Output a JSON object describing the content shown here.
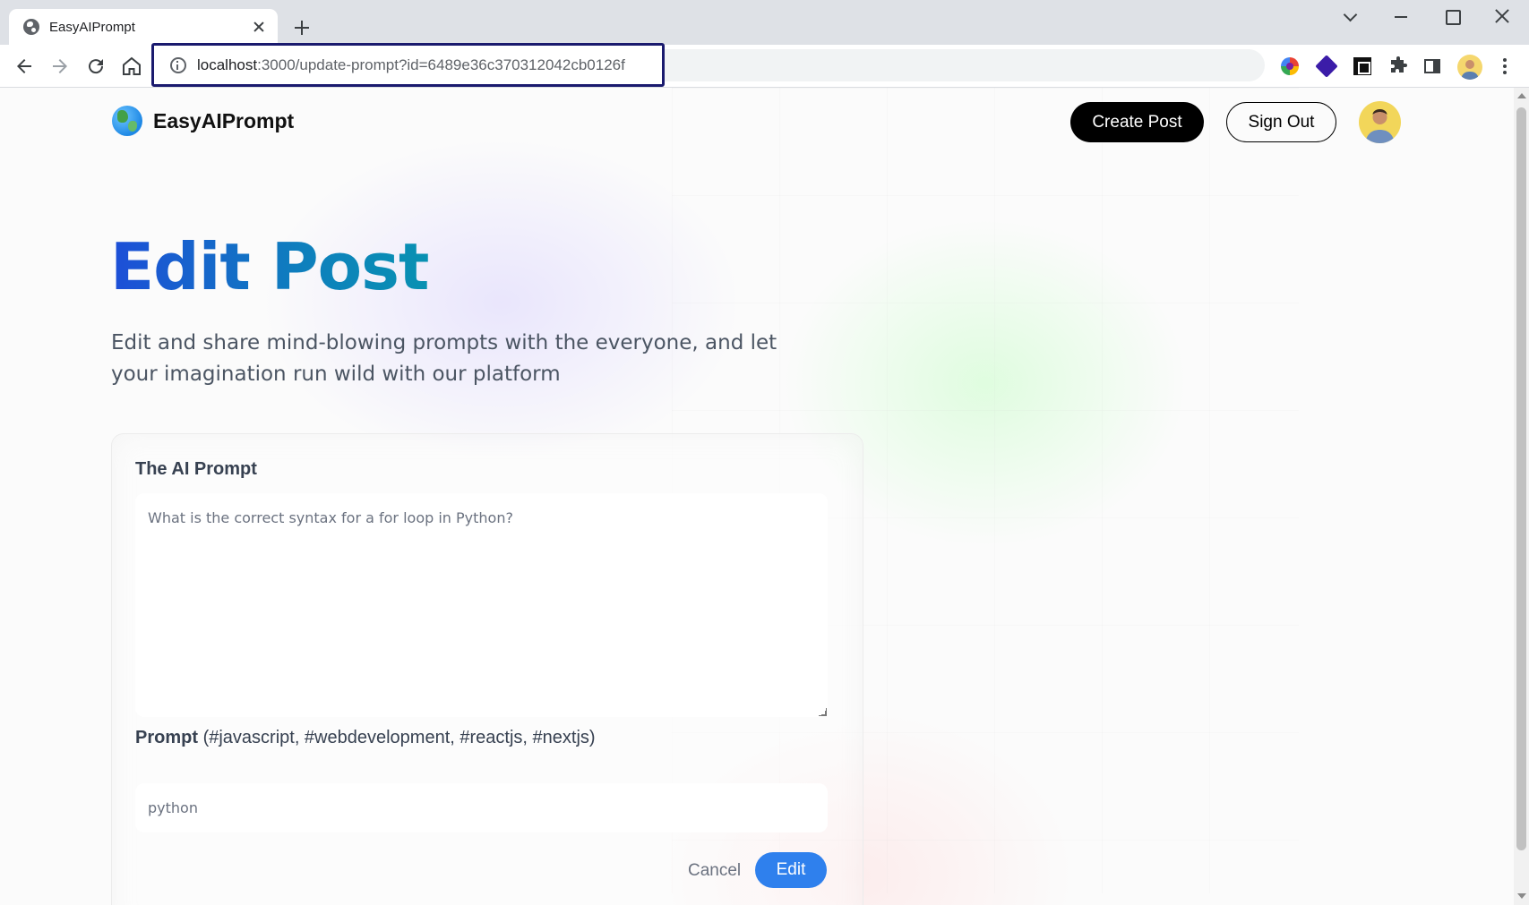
{
  "browser": {
    "tab_title": "EasyAIPrompt",
    "url_host": "localhost",
    "url_path": ":3000/update-prompt?id=6489e36c370312042cb0126f"
  },
  "nav": {
    "logo_text": "EasyAIPrompt",
    "create_label": "Create Post",
    "signout_label": "Sign Out"
  },
  "hero": {
    "title": "Edit Post",
    "description": "Edit and share mind-blowing prompts with the everyone, and let your imagination run wild with our platform"
  },
  "form": {
    "prompt_label": "The AI Prompt",
    "prompt_value": "What is the correct syntax for a for loop in Python?",
    "tag_label_bold": "Prompt",
    "tag_label_hint": "(#javascript, #webdevelopment, #reactjs, #nextjs)",
    "tag_value": "python",
    "cancel_label": "Cancel",
    "submit_label": "Edit"
  },
  "colors": {
    "title_gradient_start": "#1d4ed8",
    "title_gradient_end": "#0891b2",
    "primary_button": "#2f80ed",
    "dark_button": "#000000"
  },
  "icons": [
    "globe-icon",
    "close-icon",
    "plus-icon",
    "back-icon",
    "forward-icon",
    "reload-icon",
    "home-icon",
    "info-icon",
    "share-icon",
    "star-icon",
    "extensions-icon",
    "side-panel-icon",
    "menu-icon"
  ]
}
